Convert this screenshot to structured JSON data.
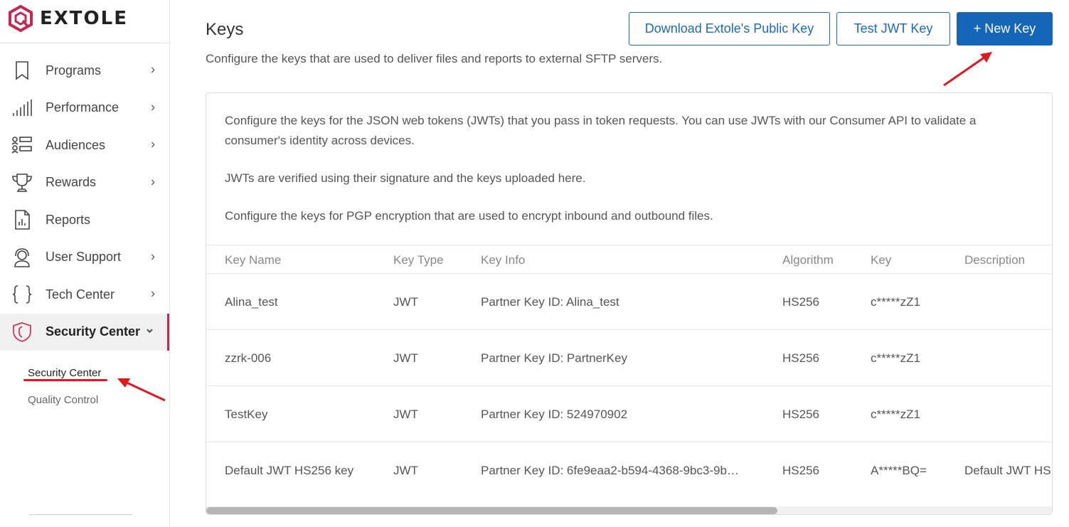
{
  "brand": {
    "name": "EXTOLE",
    "color": "#c8254f"
  },
  "sidebar": {
    "items": [
      {
        "label": "Programs",
        "icon": "bookmark-icon",
        "chevron": true
      },
      {
        "label": "Performance",
        "icon": "bar-signal-icon",
        "chevron": true
      },
      {
        "label": "Audiences",
        "icon": "audience-icon",
        "chevron": true
      },
      {
        "label": "Rewards",
        "icon": "trophy-icon",
        "chevron": true
      },
      {
        "label": "Reports",
        "icon": "report-icon",
        "chevron": false
      },
      {
        "label": "User Support",
        "icon": "headset-icon",
        "chevron": true
      },
      {
        "label": "Tech Center",
        "icon": "braces-icon",
        "chevron": true
      },
      {
        "label": "Security Center",
        "icon": "shield-icon",
        "chevron": true,
        "active": true
      }
    ],
    "sub_items": [
      {
        "label": "Security Center",
        "selected": true
      },
      {
        "label": "Quality Control",
        "selected": false
      }
    ],
    "chevron_right": "›",
    "chevron_down": "⌄"
  },
  "header": {
    "title": "Keys",
    "subtitle": "Configure the keys that are used to deliver files and reports to external SFTP servers.",
    "buttons": {
      "public_key": "Download Extole's Public Key",
      "test_jwt": "Test JWT Key",
      "new_key": "+ New Key"
    },
    "primary_color": "#1565b8"
  },
  "card": {
    "desc1": "Configure the keys for the JSON web tokens (JWTs) that you pass in token requests. You can use JWTs with our Consumer API to validate a consumer's identity across devices.",
    "desc2": "JWTs are verified using their signature and the keys uploaded here.",
    "desc3": "Configure the keys for PGP encryption that are used to encrypt inbound and outbound files."
  },
  "table": {
    "columns": [
      "Key Name",
      "Key Type",
      "Key Info",
      "Algorithm",
      "Key",
      "Description"
    ],
    "rows": [
      [
        "Alina_test",
        "JWT",
        "Partner Key ID: Alina_test",
        "HS256",
        "c*****zZ1",
        ""
      ],
      [
        "zzrk-006",
        "JWT",
        "Partner Key ID: PartnerKey",
        "HS256",
        "c*****zZ1",
        ""
      ],
      [
        "TestKey",
        "JWT",
        "Partner Key ID: 524970902",
        "HS256",
        "c*****zZ1",
        ""
      ],
      [
        "Default JWT HS256 key",
        "JWT",
        "Partner Key ID: 6fe9eaa2-b594-4368-9bc3-9b…",
        "HS256",
        "A*****BQ=",
        "Default JWT HS"
      ]
    ]
  },
  "annotation_color": "#e0191f"
}
